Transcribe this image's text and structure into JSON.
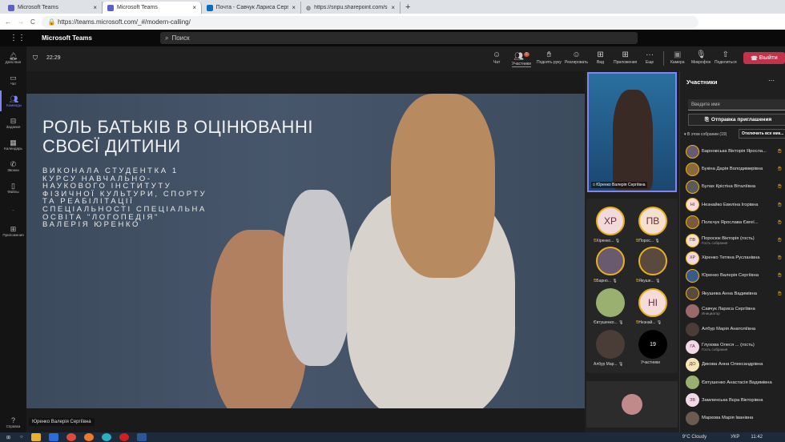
{
  "browser": {
    "tabs": [
      {
        "label": "Microsoft Teams"
      },
      {
        "label": "Microsoft Teams",
        "active": true
      },
      {
        "label": "Почта - Савчук Лариса Сергіє"
      },
      {
        "label": "https://snpu.sharepoint.com/sit"
      }
    ],
    "url": "https://teams.microsoft.com/_#/modern-calling/"
  },
  "teams": {
    "app_title": "Microsoft Teams",
    "search_placeholder": "Поиск"
  },
  "rail": [
    {
      "label": "Действия",
      "icon": "bell-icon"
    },
    {
      "label": "Чат",
      "icon": "chat-icon"
    },
    {
      "label": "Команды",
      "icon": "teams-icon",
      "selected": true
    },
    {
      "label": "Задания",
      "icon": "assignments-icon"
    },
    {
      "label": "Календарь",
      "icon": "calendar-icon"
    },
    {
      "label": "Звонки",
      "icon": "phone-icon"
    },
    {
      "label": "Файлы",
      "icon": "file-icon"
    },
    {
      "label": "...",
      "icon": "more-icon"
    },
    {
      "label": "Приложения",
      "icon": "apps-icon"
    }
  ],
  "help_label": "Справка",
  "meeting": {
    "timer": "22:29",
    "toolbar": {
      "chat": "Чат",
      "participants": "Участники",
      "participants_badge": "9",
      "raise_hand": "Поднять руку",
      "react": "Реагировать",
      "view": "Вид",
      "apps": "Приложения",
      "more": "Еще",
      "camera": "Камера",
      "mic": "Микрофон",
      "share": "Поделиться",
      "leave": "Выйти"
    }
  },
  "slide": {
    "title": "РОЛЬ БАТЬКІВ В ОЦІНЮВАННІ СВОЄЇ ДИТИНИ",
    "subtitle_lines": [
      "ВИКОНАЛА СТУДЕНТКА 1",
      "КУРСУ НАВЧАЛЬНО-",
      "НАУКОВОГО ІНСТИТУТУ",
      "ФІЗИЧНОЇ КУЛЬТУРИ, СПОРТУ",
      "ТА РЕАБІЛІТАЦІЇ",
      "СПЕЦІАЛЬНОСТІ СПЕЦІАЛЬНА",
      "ОСВІТА \"ЛОГОПЕДІЯ\"",
      "ВАЛЕРІЯ ЮРЕНКО"
    ]
  },
  "presenter_label": "Юренко Валерія Сергіївна",
  "self_video_label": "Юренко Валерія Сергіївна",
  "grid": [
    {
      "initials": "ХР",
      "name": "Хіренко...",
      "bg": "#f2d9dc"
    },
    {
      "initials": "ПВ",
      "name": "Порос...",
      "bg": "#f5e0d0"
    },
    {
      "initials": "",
      "name": "Барно...",
      "bg": "#6a5a70"
    },
    {
      "initials": "",
      "name": "Якуше...",
      "bg": "#5a4a3e"
    },
    {
      "initials": "",
      "name": "Євтушенко...",
      "bg": "#9ab070",
      "noring": true
    },
    {
      "initials": "НІ",
      "name": "Незнай...",
      "bg": "#f5dcd8"
    },
    {
      "initials": "",
      "name": "Албур Мар...",
      "bg": "#4a3c36",
      "noring": true
    }
  ],
  "grid_more": {
    "count": "19",
    "label": "Участники"
  },
  "panel": {
    "title": "Участники",
    "search_placeholder": "Введите имя",
    "invite": "Отправка приглашения",
    "section": "В этом собрании (19)",
    "mute_all": "Отключить все мик...",
    "people": [
      {
        "name": "Барновська Вікторія Яросла...",
        "hand": true,
        "bg": "#6a5a70"
      },
      {
        "name": "Букіна Дарія Володимирівна",
        "hand": true,
        "bg": "#8a6a3a"
      },
      {
        "name": "Булах Крістіна Віталіївна",
        "hand": true,
        "bg": "#5a5a5a"
      },
      {
        "name": "Незнайко Евеліна Ігорівна",
        "initials": "НІ",
        "hand": true,
        "bg": "#f5dcd8"
      },
      {
        "name": "Полєчук Ярослава Євгеї...",
        "hand": true,
        "bg": "#7a5a3a"
      },
      {
        "name": "Поросюк Вікторія (гость)",
        "sub": "Гость собрания",
        "initials": "ПВ",
        "hand": true,
        "bg": "#f5e0d0"
      },
      {
        "name": "Хіренко Тетяна Русланівна",
        "initials": "ХР",
        "hand": true,
        "bg": "#f2d9dc"
      },
      {
        "name": "Юренко Валерія Сергіївна",
        "hand": true,
        "bg": "#3a5a8a"
      },
      {
        "name": "Якушева Анна Вадимівна",
        "hand": true,
        "bg": "#5a4a3e"
      },
      {
        "name": "Савчук Лариса Сергіївна",
        "sub": "Инициатор",
        "bg": "#9a6a6a"
      },
      {
        "name": "Албур Марія Анатоліївна",
        "bg": "#4a3c36"
      },
      {
        "name": "Глухова Олеся ...  (гость)",
        "sub": "Гость собрания",
        "initials": "ГА",
        "bg": "#f2d9ea"
      },
      {
        "name": "Дикова Анна Олександрівна",
        "initials": "ДО",
        "bg": "#f7e6b5"
      },
      {
        "name": "Євтушенко Анастасія Вадимівна",
        "bg": "#9ab070"
      },
      {
        "name": "Замлинська Вєра Вікторівна",
        "initials": "ЗВ",
        "bg": "#f2d9ea"
      },
      {
        "name": "Маркова Марія Іванівна",
        "bg": "#6a5a50"
      }
    ]
  },
  "taskbar": {
    "weather": "9°C Cloudy",
    "lang": "УКР",
    "time": "11:42"
  }
}
